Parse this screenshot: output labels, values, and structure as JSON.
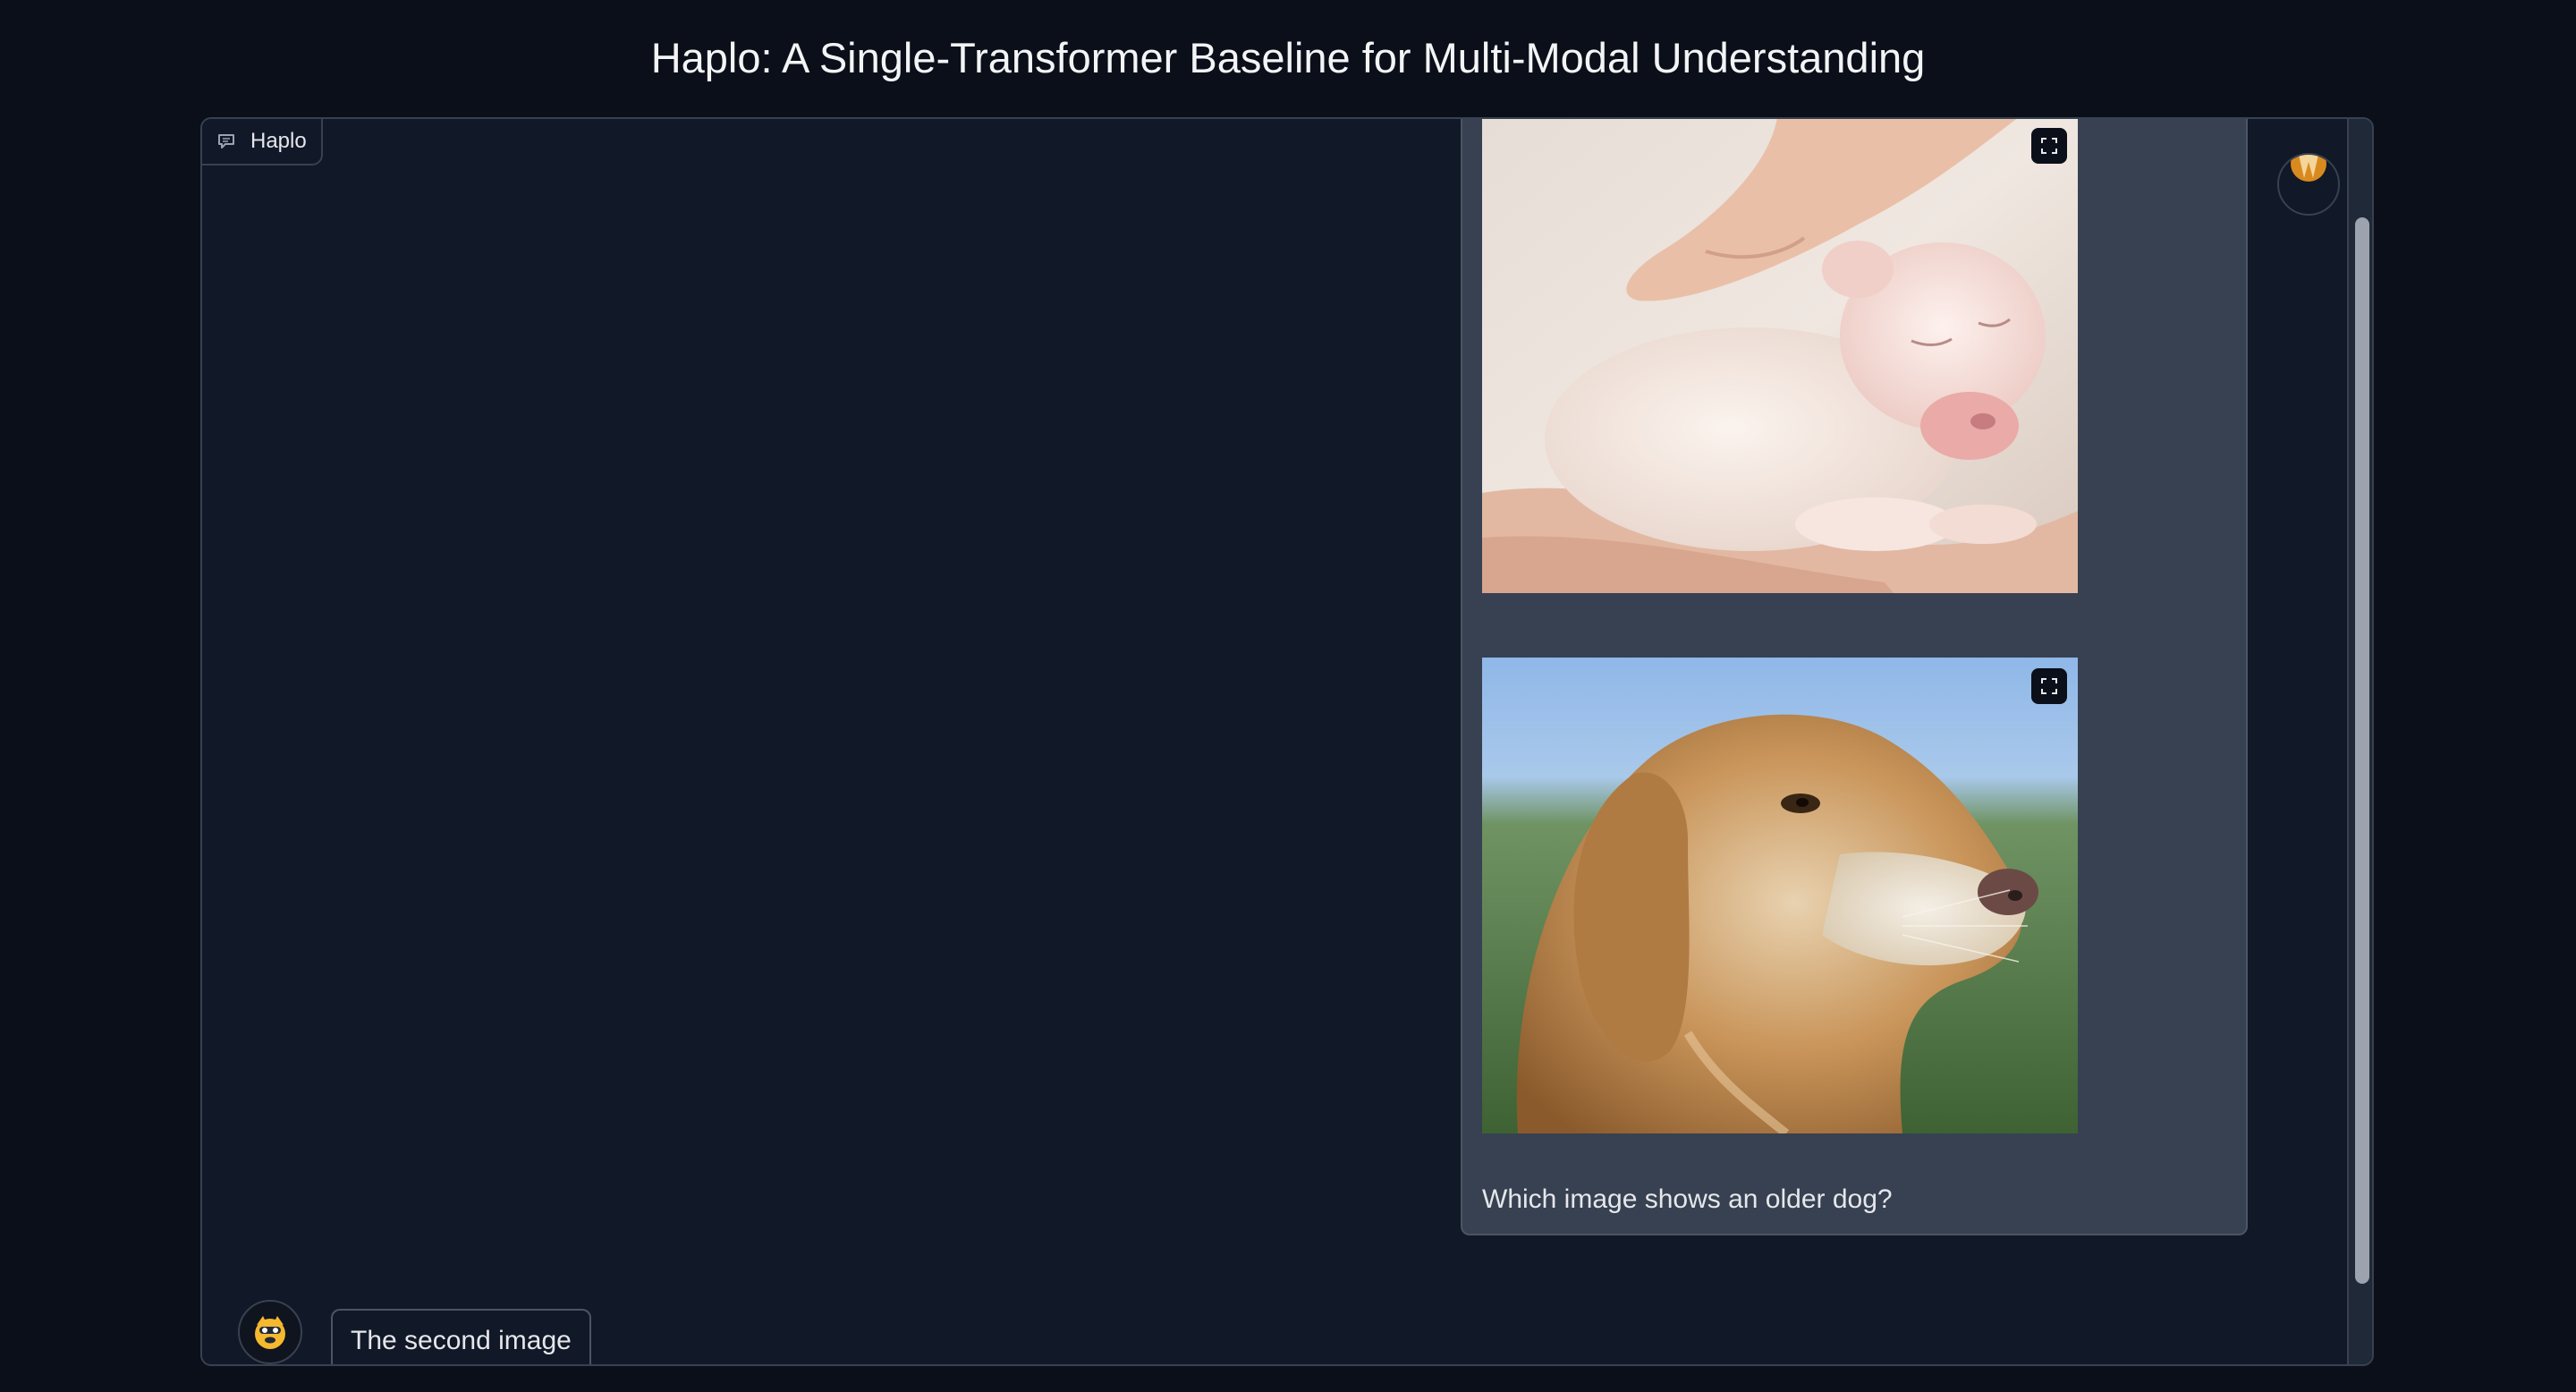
{
  "page": {
    "title": "Haplo: A Single-Transformer Baseline for Multi-Modal Understanding"
  },
  "chatbot": {
    "label": "Haplo",
    "label_icon": "chat-icon",
    "user_message": {
      "images": [
        {
          "alt": "newborn white puppy in a hand",
          "expand_icon": "fullscreen-icon"
        },
        {
          "alt": "senior golden retriever portrait",
          "expand_icon": "fullscreen-icon"
        }
      ],
      "text": "Which image shows an older dog?"
    },
    "bot_message": {
      "text": "The second image"
    },
    "user_avatar_icon": "user-avatar-icon",
    "bot_avatar_icon": "bot-avatar-icon"
  },
  "colors": {
    "background": "#0b0f19",
    "panel": "#111827",
    "user_bubble": "#374151",
    "border": "#374151",
    "text": "#e5e7eb"
  }
}
